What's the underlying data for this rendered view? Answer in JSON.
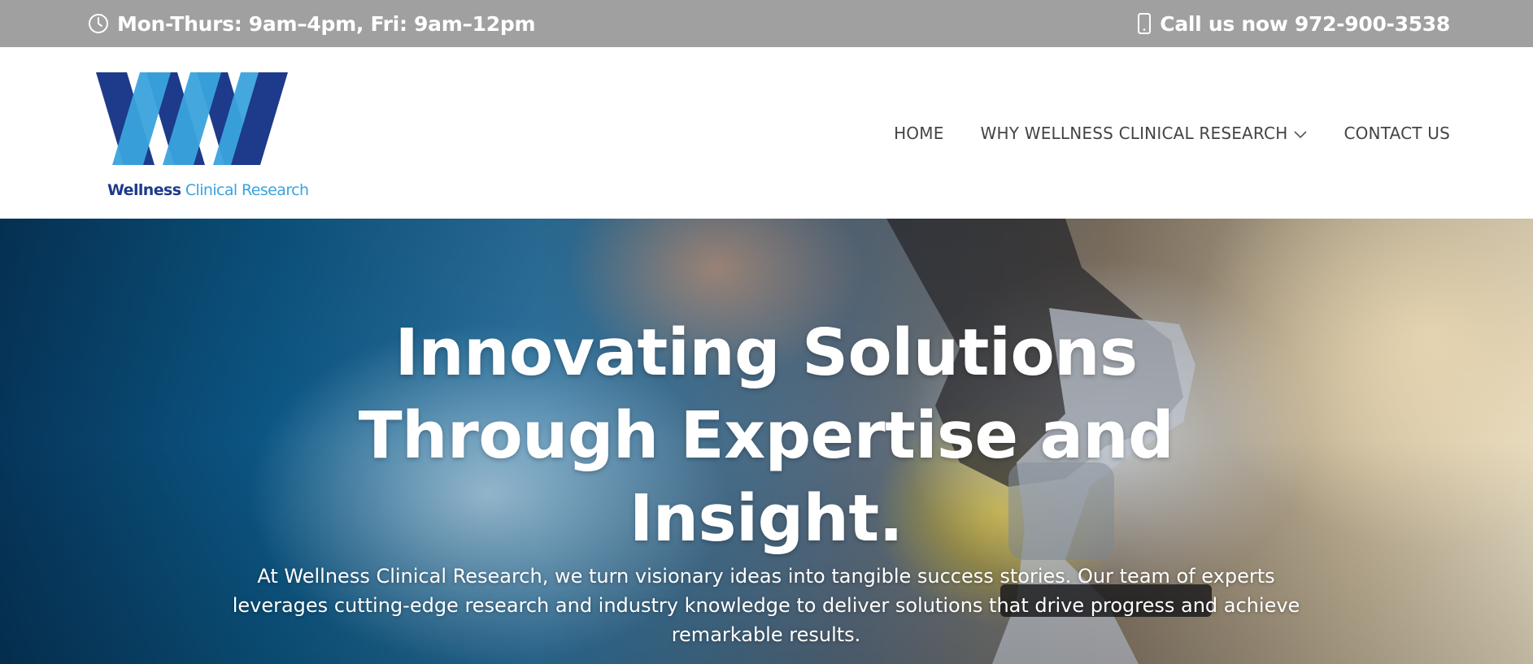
{
  "topbar": {
    "hours": "Mon-Thurs: 9am–4pm, Fri: 9am–12pm",
    "hours_icon": "clock-icon",
    "phone": "Call us now 972-900-3538",
    "phone_icon": "mobile-phone-icon"
  },
  "logo": {
    "word1": "Wellness",
    "word2": "Clinical Research",
    "colors": {
      "dark": "#1e3a8a",
      "light": "#3aa3dd"
    }
  },
  "nav": {
    "items": [
      {
        "label": "HOME"
      },
      {
        "label": "WHY WELLNESS CLINICAL RESEARCH",
        "icon": "chevron-down-icon"
      },
      {
        "label": "CONTACT US"
      }
    ]
  },
  "hero": {
    "title": "Innovating Solutions Through Expertise and Insight.",
    "subtitle": "At Wellness Clinical Research, we turn visionary ideas into tangible success stories. Our team of experts leverages cutting-edge research and industry knowledge to deliver solutions that drive progress and achieve remarkable results."
  },
  "colors": {
    "topbar_bg": "#a0a0a0",
    "nav_text": "#444444"
  }
}
